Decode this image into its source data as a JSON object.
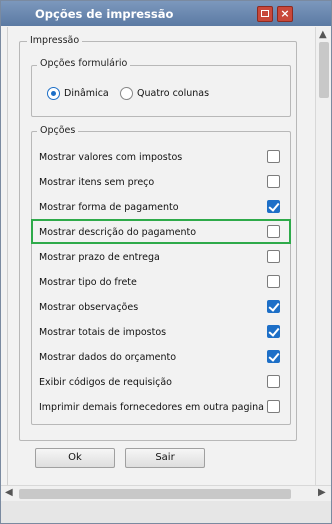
{
  "window": {
    "title": "Opções de impressão"
  },
  "groups": {
    "impressao_label": "Impressão",
    "formulario_label": "Opções formulário",
    "opcoes_label": "Opções"
  },
  "formulario": {
    "options": [
      {
        "label": "Dinâmica",
        "checked": true
      },
      {
        "label": "Quatro colunas",
        "checked": false
      }
    ]
  },
  "opcoes": {
    "items": [
      {
        "label": "Mostrar valores com impostos",
        "checked": false
      },
      {
        "label": "Mostrar itens sem preço",
        "checked": false
      },
      {
        "label": "Mostrar forma de pagamento",
        "checked": true
      },
      {
        "label": "Mostrar descrição do pagamento",
        "checked": false
      },
      {
        "label": "Mostrar prazo de entrega",
        "checked": false
      },
      {
        "label": "Mostrar tipo do frete",
        "checked": false
      },
      {
        "label": "Mostrar observações",
        "checked": true
      },
      {
        "label": "Mostrar totais de impostos",
        "checked": true
      },
      {
        "label": "Mostrar dados do orçamento",
        "checked": true
      },
      {
        "label": "Exibir códigos de requisição",
        "checked": false
      },
      {
        "label": "Imprimir demais fornecedores em outra pagina",
        "checked": false
      }
    ]
  },
  "buttons": {
    "ok": "Ok",
    "sair": "Sair"
  },
  "colors": {
    "titlebar": "#5b7aa3",
    "accent": "#1d6fc7",
    "highlight": "#2eaa4a"
  }
}
